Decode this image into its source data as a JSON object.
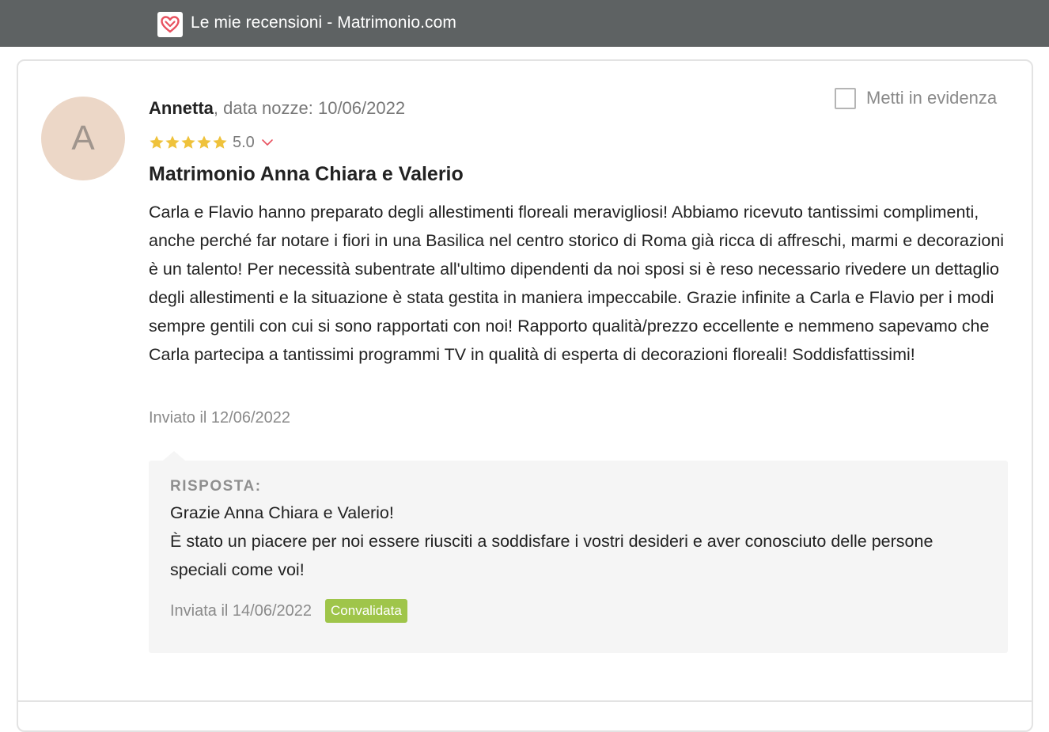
{
  "window": {
    "title": "Le mie recensioni - Matrimonio.com",
    "favicon_icon": "heart-logo-icon",
    "brand_color": "#e8515f"
  },
  "review": {
    "avatar_letter": "A",
    "author": "Annetta",
    "wedding_date_text": ", data nozze: 10/06/2022",
    "feature_label": "Metti in evidenza",
    "rating": {
      "stars": 5,
      "score_label": "5.0",
      "star_color": "#efc23b"
    },
    "title": "Matrimonio Anna Chiara e Valerio",
    "body": "Carla e Flavio hanno preparato degli allestimenti floreali meravigliosi! Abbiamo ricevuto tantissimi complimenti, anche perché far notare i fiori in una Basilica nel centro storico di Roma già ricca di affreschi, marmi e decorazioni è un talento! Per necessità subentrate all'ultimo dipendenti da noi sposi si è reso necessario rivedere un dettaglio degli allestimenti e la situazione è stata gestita in maniera impeccabile. Grazie infinite a Carla e Flavio per i modi sempre gentili con cui si sono rapportati con noi! Rapporto qualità/prezzo eccellente e nemmeno sapevamo che Carla partecipa a tantissimi programmi TV in qualità di esperta di decorazioni floreali! Soddisfattissimi!",
    "sent_label": "Inviato il 12/06/2022"
  },
  "reply": {
    "header": "RISPOSTA:",
    "line1": "Grazie Anna Chiara e Valerio!",
    "line2": "È stato un piacere per noi essere riusciti a soddisfare i vostri desideri e aver conosciuto delle persone speciali come voi!",
    "sent_label": "Inviata il 14/06/2022",
    "status_badge": "Convalidata",
    "status_color": "#9fc54a"
  }
}
